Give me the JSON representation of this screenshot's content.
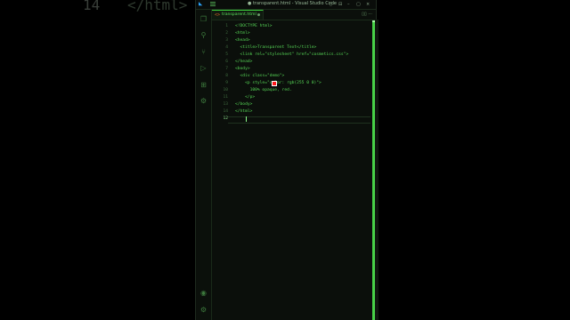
{
  "background_code": {
    "line_number": "14",
    "text": "</html>"
  },
  "window": {
    "title": "● transparent.html - Visual Studio Code",
    "controls": [
      "▯",
      "⊟",
      "–",
      "▢",
      "×"
    ]
  },
  "activity_bar": {
    "icons": [
      "files-icon",
      "search-icon",
      "source-control-icon",
      "run-debug-icon",
      "extensions-icon",
      "remote-icon",
      "accounts-icon",
      "settings-gear-icon"
    ]
  },
  "tabs": [
    {
      "label": "transparent.html",
      "modified": true,
      "active": true
    }
  ],
  "editor": {
    "line_numbers": [
      "1",
      "2",
      "3",
      "4",
      "5",
      "6",
      "7",
      "8",
      "9",
      "10",
      "11",
      "12",
      "13",
      "14"
    ],
    "lines": [
      "<!DOCTYPE html>",
      "<html>",
      "<head>",
      "  <title>Transparent Text</title>",
      "  <link rel=\"stylesheet\" href=\"cosmetics.css\">",
      "</head>",
      "<body>",
      "  <div class=\"demo\">",
      "    <p style=\"color: rgb(255 0 0)\">",
      "      100% opaque, red.",
      "    </p>",
      "",
      "</body>",
      "</html>"
    ],
    "active_line": "12",
    "swatch_color": "#ff0000"
  },
  "colors": {
    "accent": "#3bd23b",
    "background": "#000000"
  }
}
